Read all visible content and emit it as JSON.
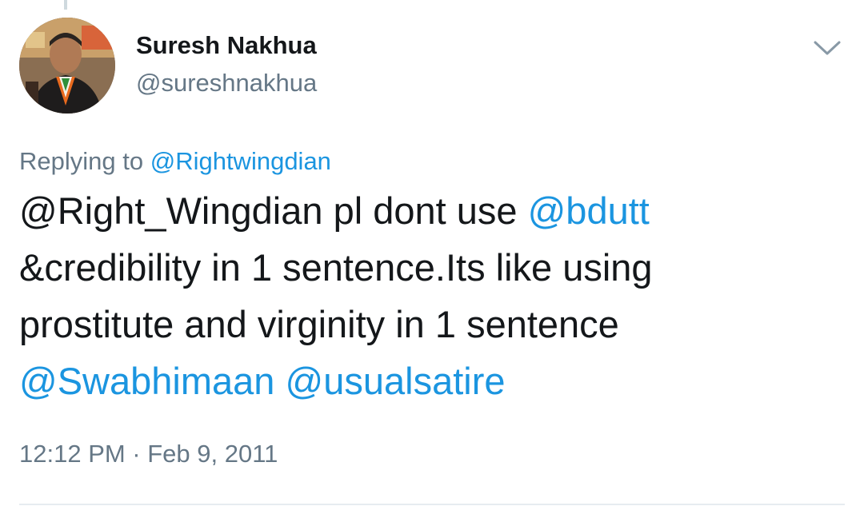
{
  "author": {
    "display_name": "Suresh Nakhua",
    "handle": "@sureshnakhua"
  },
  "reply_context": {
    "prefix": "Replying to",
    "mention": "@Rightwingdian"
  },
  "tweet": {
    "line1_mention": "@Right_Wingdian",
    "line1_text": " pl dont use ",
    "line1_mention2": "@bdutt",
    "line2_text": "&credibility in 1 sentence.Its like using",
    "line3_text": "prostitute and virginity in 1 sentence",
    "line4_mention1": "@Swabhimaan",
    "line4_mention2": "@usualsatire"
  },
  "meta": {
    "timestamp": "12:12 PM · Feb 9, 2011"
  },
  "icons": {
    "more": "chevron-down-icon",
    "avatar": "avatar"
  },
  "colors": {
    "link": "#1b95e0",
    "secondary_text": "#657786",
    "primary_text": "#14171a",
    "divider": "#e6ecf0"
  }
}
